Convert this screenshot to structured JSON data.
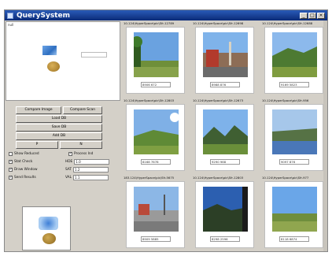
{
  "window": {
    "title": "QuerySystem",
    "controls": [
      "_",
      "□",
      "×"
    ]
  },
  "query": {
    "label": "null"
  },
  "buttons": {
    "compare_image": "Compare Image",
    "compare_scan": "Compare Scan",
    "load_db": "Load DB",
    "save_db": "Save DB",
    "add_db": "Add DB",
    "prev": "P",
    "next": "N"
  },
  "options": {
    "show_reduced": {
      "label": "Show Reduced",
      "checked": false
    },
    "process_ind": {
      "label": "Process Ind",
      "checked": true
    },
    "stat_check": {
      "label": "Stat Check",
      "checked": true
    },
    "draw_window": {
      "label": "Draw Window",
      "checked": true
    },
    "send_results": {
      "label": "Send Results",
      "checked": true
    }
  },
  "fields": {
    "hdr": {
      "label": "HDE",
      "value": "1.0"
    },
    "sat": {
      "label": "SAT",
      "value": "1.2"
    },
    "val": {
      "label": "VAL",
      "value": "1.1"
    }
  },
  "results": [
    {
      "title": "10.124\\HyperSpace\\pic\\Sfr-12789",
      "score": "8906 672"
    },
    {
      "title": "10.124\\HyperSpace\\pic\\Sfr-12698",
      "score": "8988 876"
    },
    {
      "title": "10.124\\HyperSpace\\pic\\Sfr-12688",
      "score": "9169 5823"
    },
    {
      "title": "10.124\\HyperSpace\\pic\\Sfr-12803",
      "score": "8168 7678"
    },
    {
      "title": "10.124\\HyperSpace\\pic\\Sfr-12673",
      "score": "9290 968"
    },
    {
      "title": "10.124\\HyperSpace\\pic\\Sfr-956",
      "score": "9097 876"
    },
    {
      "title": "183.124\\HyperSpace\\pic\\Sfr-5675",
      "score": "8909 5885"
    },
    {
      "title": "10.124\\HyperSpace\\pic\\Sfr-12803",
      "score": "8298 2596"
    },
    {
      "title": "10.124\\HyperSpace\\pic\\Sfr-977",
      "score": "8118 6874"
    }
  ],
  "colors": {
    "titlebar": "#0a2a78",
    "panel": "#d4d0c8"
  }
}
